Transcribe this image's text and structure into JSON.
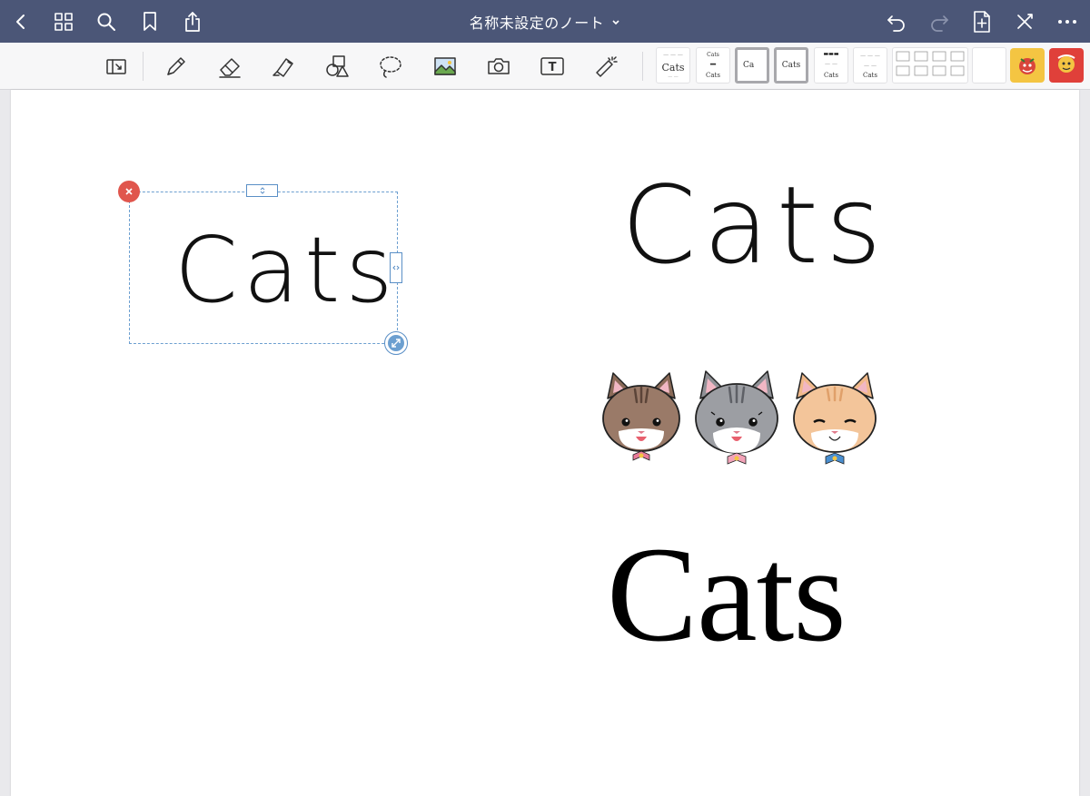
{
  "window": {
    "title": "名称未設定のノート"
  },
  "titlebar": {
    "left": [
      {
        "name": "back-icon"
      },
      {
        "name": "thumbnails-grid-icon"
      },
      {
        "name": "search-icon"
      },
      {
        "name": "bookmark-icon"
      },
      {
        "name": "share-icon"
      }
    ],
    "right": [
      {
        "name": "undo-icon",
        "enabled": true
      },
      {
        "name": "redo-icon",
        "enabled": false
      },
      {
        "name": "add-page-icon",
        "enabled": true
      },
      {
        "name": "close-edit-icon",
        "enabled": true
      },
      {
        "name": "more-icon",
        "enabled": true
      }
    ]
  },
  "toolbar": {
    "tools": [
      {
        "name": "read-mode-icon"
      },
      {
        "name": "pen-icon"
      },
      {
        "name": "eraser-icon"
      },
      {
        "name": "highlighter-icon"
      },
      {
        "name": "shapes-icon"
      },
      {
        "name": "lasso-icon"
      },
      {
        "name": "image-icon"
      },
      {
        "name": "camera-icon"
      },
      {
        "name": "text-tool-icon"
      },
      {
        "name": "laser-pointer-icon"
      }
    ],
    "text_tool_glyph": "T",
    "presets": [
      {
        "label": "Cats",
        "selected": false
      },
      {
        "label": "Cats",
        "selected": false
      },
      {
        "label": "Ca",
        "selected": true
      },
      {
        "label": "Cats",
        "selected": true
      },
      {
        "label": "Cats",
        "selected": false
      },
      {
        "label": "Cats",
        "selected": false
      },
      {
        "label": "",
        "selected": false
      },
      {
        "label": "",
        "selected": false
      },
      {
        "label": "",
        "selected": false
      }
    ],
    "stickers": [
      {
        "name": "sticker-yellow-character",
        "color": "#f4c542"
      },
      {
        "name": "sticker-red-character",
        "color": "#e0403a"
      }
    ]
  },
  "canvas": {
    "selected_text": "Cats",
    "handwritten_text": "Cats",
    "serif_text": "Cats",
    "cats": [
      {
        "name": "brown-tabby-cat",
        "fur": "#9a7a68",
        "bow": "#e87a9a"
      },
      {
        "name": "gray-tabby-cat",
        "fur": "#9c9ea3",
        "bow": "#f3a3b8"
      },
      {
        "name": "orange-cat",
        "fur": "#f3c59a",
        "bow": "#4a8fd0"
      }
    ]
  },
  "colors": {
    "titlebar": "#4b5677",
    "selection": "#6c9fd0",
    "delete": "#e0564d"
  }
}
